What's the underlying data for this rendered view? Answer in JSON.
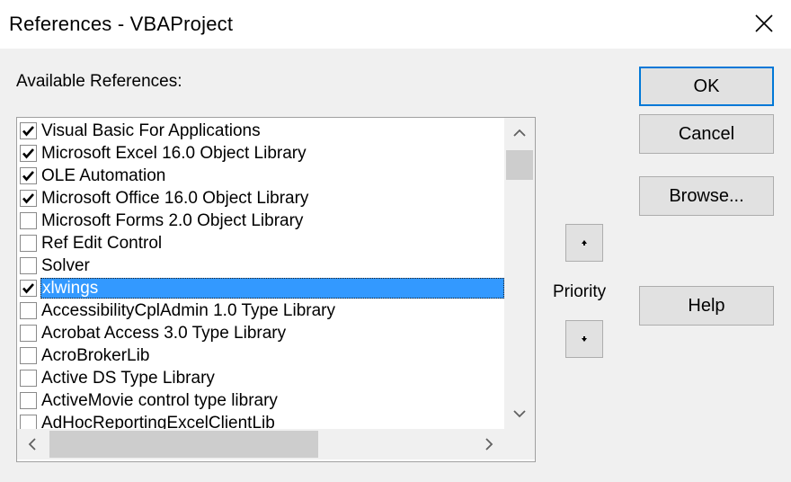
{
  "window": {
    "title": "References - VBAProject"
  },
  "available_label": "Available References:",
  "references": [
    {
      "label": "Visual Basic For Applications",
      "checked": true,
      "selected": false
    },
    {
      "label": "Microsoft Excel 16.0 Object Library",
      "checked": true,
      "selected": false
    },
    {
      "label": "OLE Automation",
      "checked": true,
      "selected": false
    },
    {
      "label": "Microsoft Office 16.0 Object Library",
      "checked": true,
      "selected": false
    },
    {
      "label": "Microsoft Forms 2.0 Object Library",
      "checked": false,
      "selected": false
    },
    {
      "label": "Ref Edit Control",
      "checked": false,
      "selected": false
    },
    {
      "label": "Solver",
      "checked": false,
      "selected": false
    },
    {
      "label": "xlwings",
      "checked": true,
      "selected": true
    },
    {
      "label": "AccessibilityCplAdmin 1.0 Type Library",
      "checked": false,
      "selected": false
    },
    {
      "label": "Acrobat Access 3.0 Type Library",
      "checked": false,
      "selected": false
    },
    {
      "label": "AcroBrokerLib",
      "checked": false,
      "selected": false
    },
    {
      "label": "Active DS Type Library",
      "checked": false,
      "selected": false
    },
    {
      "label": "ActiveMovie control type library",
      "checked": false,
      "selected": false
    },
    {
      "label": "AdHocReportingExcelClientLib",
      "checked": false,
      "selected": false
    }
  ],
  "buttons": {
    "ok": "OK",
    "cancel": "Cancel",
    "browse": "Browse...",
    "help": "Help"
  },
  "priority": {
    "label": "Priority"
  },
  "icons": {
    "close": "close-icon",
    "priority_up": "arrow-up-icon",
    "priority_down": "arrow-down-icon"
  },
  "colors": {
    "selection": "#3399ff",
    "default_button_border": "#0078d7",
    "dialog_background": "#f0f0f0"
  }
}
